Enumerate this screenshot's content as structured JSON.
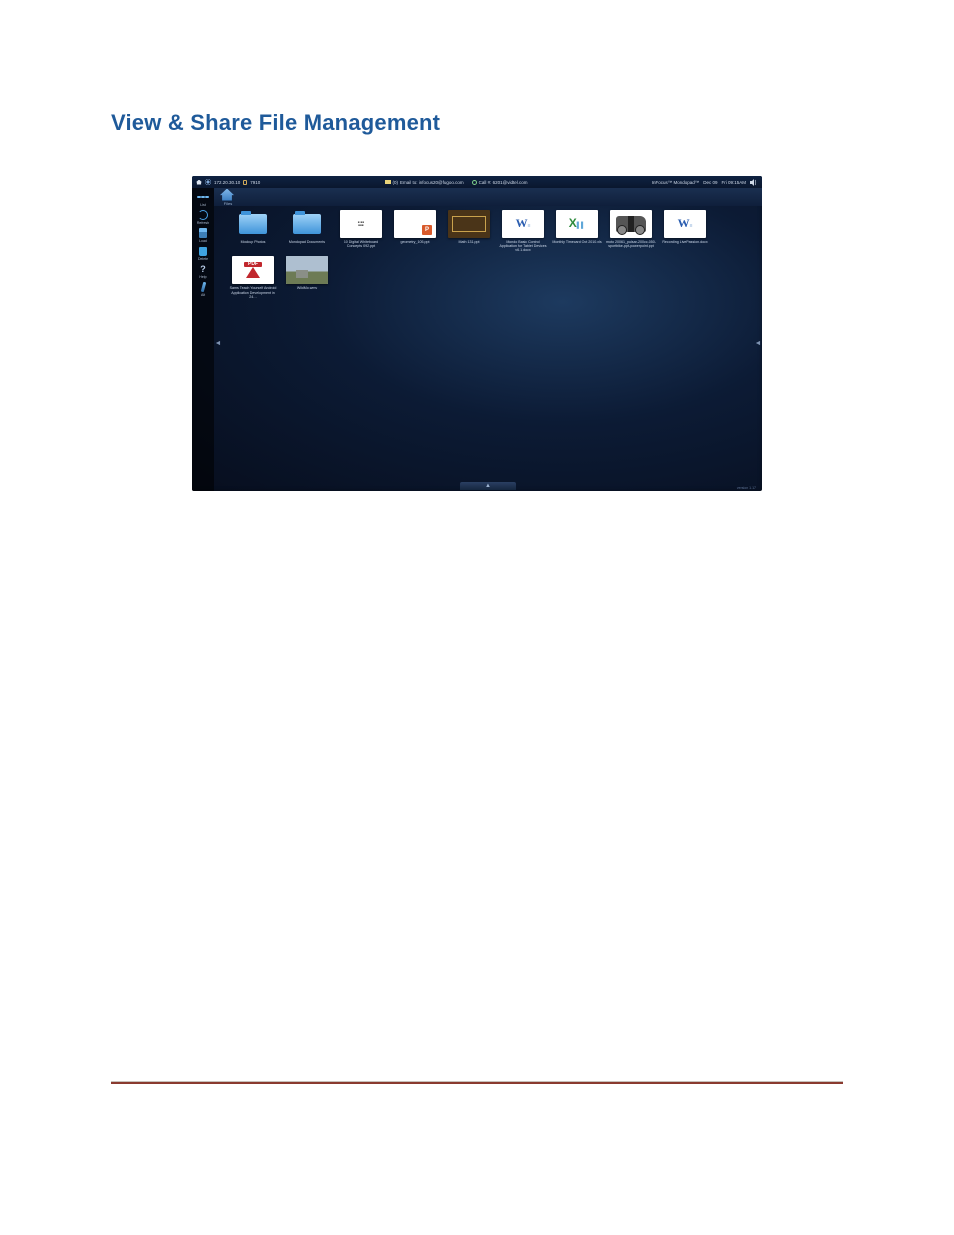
{
  "page": {
    "section_title": "View & Share File Management"
  },
  "topbar": {
    "ip": "172.20.30.10",
    "lock_label": "7910",
    "mail_count": "(0)",
    "mail_label": "Email to: infocus20@fugoo.com",
    "call_label": "Call #: 6201@vidtel.com",
    "brand": "InFocus™ Mondopad™",
    "date": "Dec 09",
    "time": "Fri 09:15AM"
  },
  "lefttb": {
    "list": "List",
    "refresh": "Refresh",
    "load": "Load",
    "delete": "Delete",
    "help": "Help",
    "alt": "Alt"
  },
  "crumb": {
    "label": "Files"
  },
  "files": [
    {
      "label": "Mockup Photos",
      "type": "folder"
    },
    {
      "label": "Mondopad Documents",
      "type": "folder"
    },
    {
      "label": "10 Digital Whiteboard Concepts 092.ppt",
      "type": "whitepage"
    },
    {
      "label": "geometry_105.ppt",
      "type": "ppt"
    },
    {
      "label": "Math 131.ppt",
      "type": "darkslide"
    },
    {
      "label": "Mondo Basic Control Application for Tablet Devices v6.1.docx",
      "type": "word"
    },
    {
      "label": "Monthly Timecard Oct 2010.xls",
      "type": "excel"
    },
    {
      "label": "moto 20061_pulsar-200cc-050-sportbike-ppt-powerpoint.ppt",
      "type": "moto"
    },
    {
      "label": "Recording LivePassion.docx",
      "type": "word"
    },
    {
      "label": "Sams Teach Yourself Android Application Development in 24…",
      "type": "pdf"
    },
    {
      "label": "WildMo.wmv",
      "type": "photo"
    }
  ],
  "version": "version 1.17"
}
